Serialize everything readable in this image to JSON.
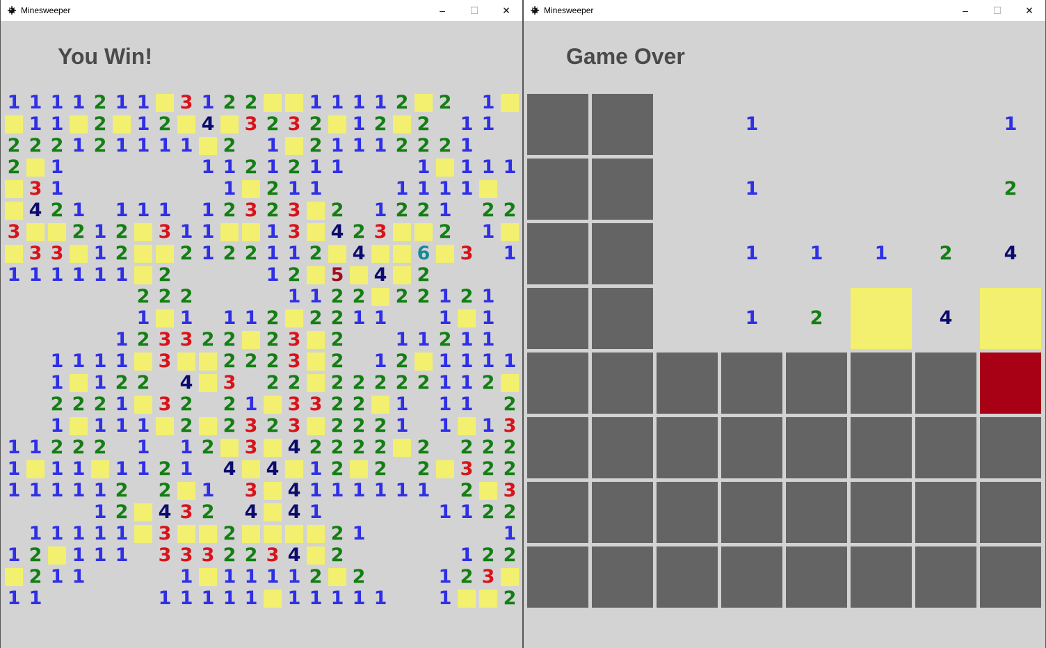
{
  "colors": {
    "1": "#2f2fe6",
    "2": "#137f13",
    "3": "#d9131a",
    "4": "#0c0c6e",
    "5": "#a10e1c",
    "6": "#178a99",
    "flag": "#f2f06e",
    "hidden": "#646464",
    "mine": "#a80015"
  },
  "left_window": {
    "title": "Minesweeper",
    "status": "You Win!",
    "board": [
      "1111211.3122..11112.2 1.",
      ".11.2.12.4.3232.12.2 11",
      "222121111.2 1.21112221",
      "2.1      1121211   1.111",
      ".31       1.211   1111.",
      ".421 111 12323.2 1221 22",
      "3..212.311..13.423..2 1.",
      ".33.12..2122112.4..6.3 11",
      "111111.2    12.5.4.2",
      "      222    1122.22121 1",
      "      1.1 112.2211  1.1",
      "     123322.23.2  11211",
      "  1111.3..2223.2 12.1111",
      "  1.122 4.3 22.22222112.2 11.2",
      "  2221.32 21.3322.1 11 21 23.",
      "  1.111.2.2323.2221 1.13.",
      "11222 1 12.3.42222.2 2222.",
      "1.11.1121 4.4.12.2 2.322",
      "111112 2.1 3.4111111 2.3.1",
      "    12.432 4.41     11222",
      " 11111.3..2....21      1.",
      "12.111 3332234.2     122",
      ".211    1.11112.2   123.1",
      "11     11111.11111  1..21"
    ]
  },
  "right_window": {
    "title": "Minesweeper",
    "status": "Game Over",
    "board": [
      "## 1   11",
      "## 1   2.",
      "## 11124.",
      "## 12.4..",
      "#######X",
      "########",
      "########",
      "########"
    ]
  }
}
